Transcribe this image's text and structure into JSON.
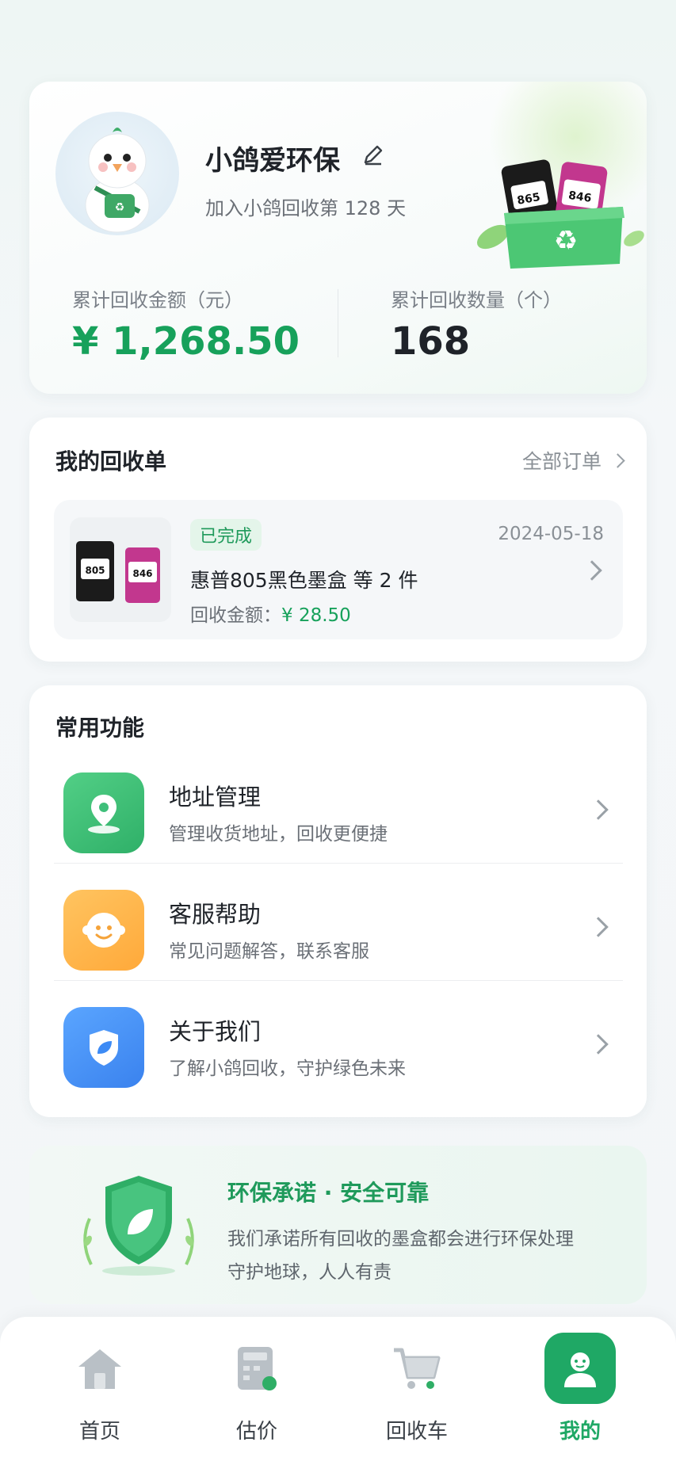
{
  "profile": {
    "nickname": "小鸽爱环保",
    "joined_text": "加入小鸽回收第 128 天",
    "stats": {
      "amount_label": "累计回收金额（元）",
      "amount_value": "¥ 1,268.50",
      "count_label": "累计回收数量（个）",
      "count_value": "168"
    },
    "icons": [
      "pigeon-avatar",
      "edit-icon",
      "recycle-box-illustration"
    ]
  },
  "orders": {
    "title": "我的回收单",
    "all_link": "全部订单",
    "latest": {
      "status": "已完成",
      "date": "2024-05-18",
      "name": "惠普805黑色墨盒 等 2 件",
      "amount_label": "回收金额：",
      "amount_value": "¥ 28.50",
      "thumb_labels": [
        "805",
        "846"
      ]
    }
  },
  "functions": {
    "title": "常用功能",
    "items": [
      {
        "title": "地址管理",
        "subtitle": "管理收货地址，回收更便捷",
        "icon": "location-icon",
        "color": "#3fbf7a"
      },
      {
        "title": "客服帮助",
        "subtitle": "常见问题解答，联系客服",
        "icon": "smile-icon",
        "color": "#ffb84d"
      },
      {
        "title": "关于我们",
        "subtitle": "了解小鸽回收，守护绿色未来",
        "icon": "shield-leaf-icon",
        "color": "#3d8bf5"
      }
    ]
  },
  "promise": {
    "title": "环保承诺 · 安全可靠",
    "line1": "我们承诺所有回收的墨盒都会进行环保处理",
    "line2": "守护地球，人人有责"
  },
  "tabs": [
    {
      "label": "首页",
      "icon": "home-icon",
      "active": false
    },
    {
      "label": "估价",
      "icon": "calculator-icon",
      "active": false
    },
    {
      "label": "回收车",
      "icon": "cart-icon",
      "active": false
    },
    {
      "label": "我的",
      "icon": "user-icon",
      "active": true
    }
  ],
  "colors": {
    "accent": "#1fa865",
    "amount": "#17a15b"
  }
}
